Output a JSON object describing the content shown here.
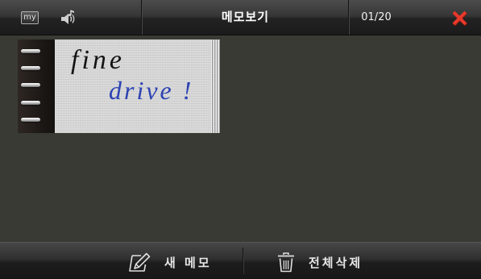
{
  "header": {
    "my_label": "my",
    "my_icon": "my-menu-icon",
    "sound_icon": "speaker-icon",
    "title": "메모보기",
    "page_counter": "01/20",
    "close_icon": "close-icon"
  },
  "memos": [
    {
      "icon": "spiral-notebook",
      "lines": [
        {
          "text": "fine",
          "color": "#141414"
        },
        {
          "text": "drive !",
          "color": "#2e43b2"
        }
      ]
    }
  ],
  "footer": {
    "new_memo": {
      "label": "새 메모",
      "icon": "pen-memo-icon"
    },
    "delete_all": {
      "label": "전체삭제",
      "icon": "trash-icon"
    }
  },
  "colors": {
    "background": "#3a3a34",
    "bar": "#262626",
    "close_accent": "#e8392b",
    "text": "#ffffff"
  }
}
